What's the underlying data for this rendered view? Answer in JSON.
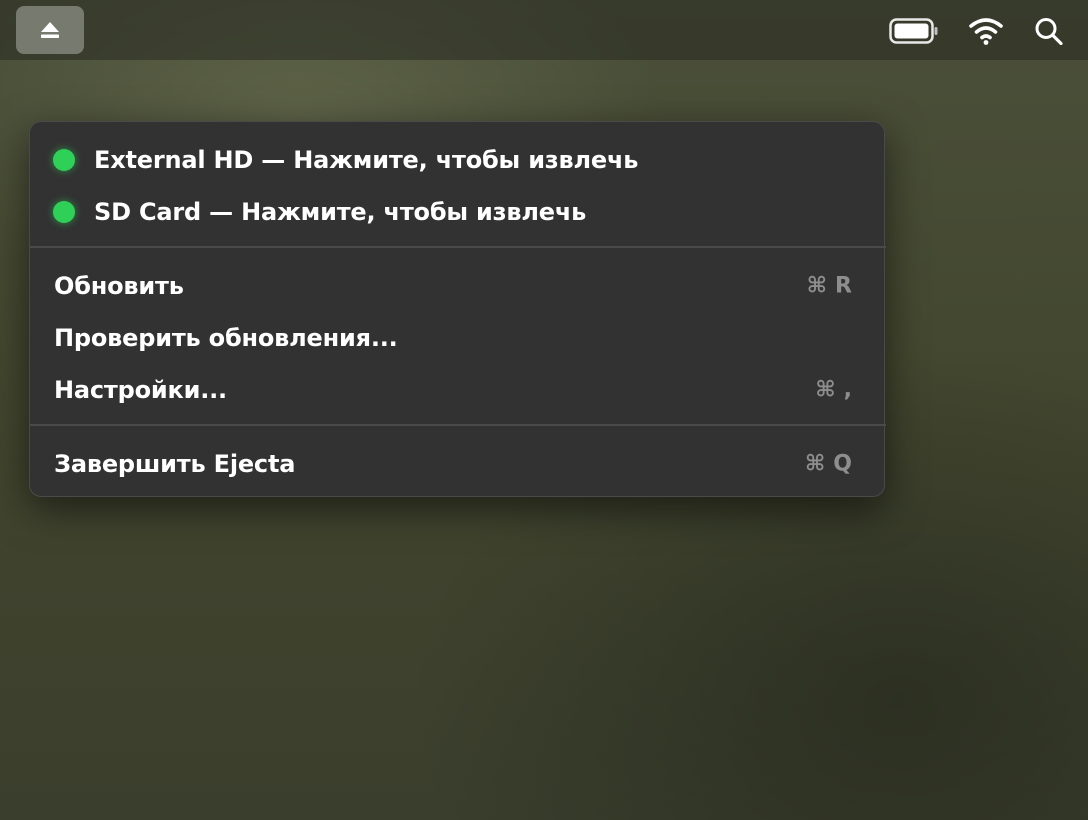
{
  "menubar": {
    "eject_icon": "eject-icon",
    "battery_icon": "battery-icon",
    "wifi_icon": "wifi-icon",
    "search_icon": "search-icon"
  },
  "menu": {
    "devices": [
      {
        "label": "External HD — Нажмите, чтобы извлечь",
        "status_color": "#2fd058"
      },
      {
        "label": "SD Card — Нажмите, чтобы извлечь",
        "status_color": "#2fd058"
      }
    ],
    "refresh": {
      "label": "Обновить",
      "shortcut": "⌘R"
    },
    "check_updates": {
      "label": "Проверить обновления..."
    },
    "settings": {
      "label": "Настройки...",
      "shortcut": "⌘,"
    },
    "quit": {
      "label": "Завершить Ejecta",
      "shortcut": "⌘Q"
    }
  },
  "colors": {
    "menu_background": "#323232",
    "status_green": "#2fd058",
    "shortcut_gray": "#8e8e8e"
  }
}
